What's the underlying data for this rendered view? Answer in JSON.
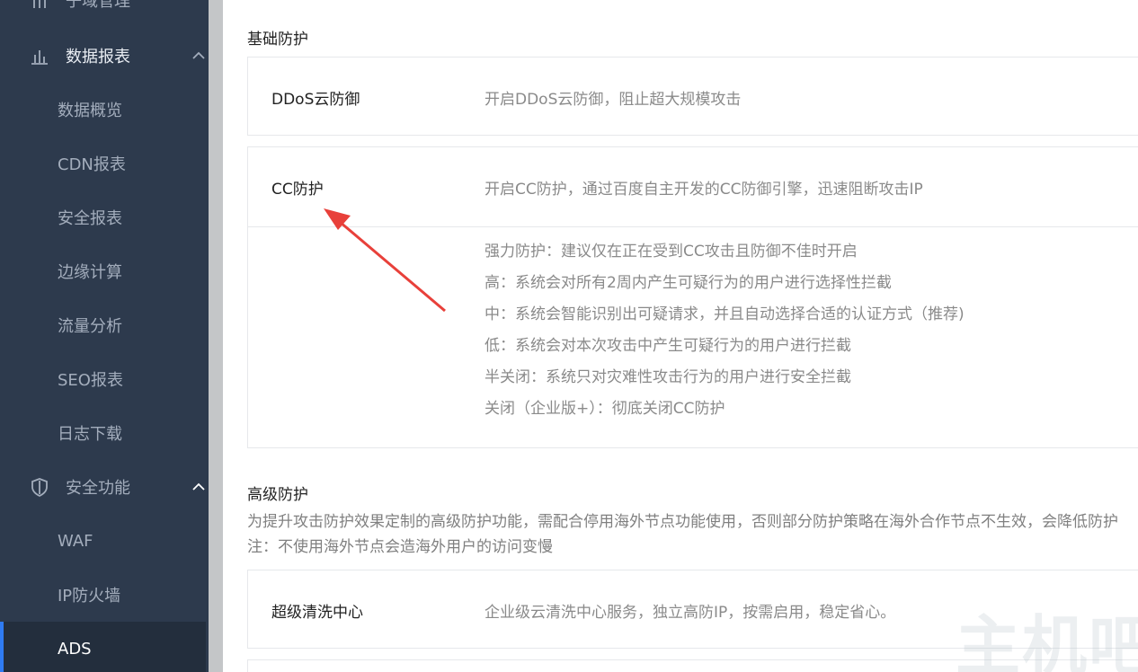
{
  "sidebar": {
    "top_partial": {
      "label": "子域管理"
    },
    "groups": [
      {
        "label": "数据报表",
        "items": [
          "数据概览",
          "CDN报表",
          "安全报表",
          "边缘计算",
          "流量分析",
          "SEO报表",
          "日志下载"
        ]
      },
      {
        "label": "安全功能",
        "items": [
          "WAF",
          "IP防火墙",
          "ADS"
        ]
      }
    ],
    "active_item": "ADS"
  },
  "main": {
    "basic": {
      "title": "基础防护",
      "ddos": {
        "label": "DDoS云防御",
        "desc": "开启DDoS云防御，阻止超大规模攻击"
      },
      "cc": {
        "label": "CC防护",
        "desc": "开启CC防护，通过百度自主开发的CC防御引擎，迅速阻断攻击IP",
        "options": [
          "强力防护：建议仅在正在受到CC攻击且防御不佳时开启",
          "高：系统会对所有2周内产生可疑行为的用户进行选择性拦截",
          "中：系统会智能识别出可疑请求，并且自动选择合适的认证方式（推荐)",
          "低：系统会对本次攻击中产生可疑行为的用户进行拦截",
          "半关闭：系统只对灾难性攻击行为的用户进行安全拦截",
          "关闭（企业版+）：彻底关闭CC防护"
        ]
      }
    },
    "advanced": {
      "title": "高级防护",
      "desc_line1": "为提升攻击防护效果定制的高级防护功能，需配合停用海外节点功能使用，否则部分防护策略在海外合作节点不生效，会降低防护",
      "desc_line2": "注：不使用海外节点会造海外用户的访问变慢",
      "scrubbing": {
        "label": "超级清洗中心",
        "desc": "企业级云清洗中心服务，独立高防IP，按需启用，稳定省心。"
      }
    },
    "watermark": "主机吧"
  },
  "colors": {
    "sidebar_bg": "#2d3a4d",
    "sidebar_active_bg": "#232e3d",
    "accent": "#2f7bf2",
    "annotation_arrow": "#e8403a"
  }
}
